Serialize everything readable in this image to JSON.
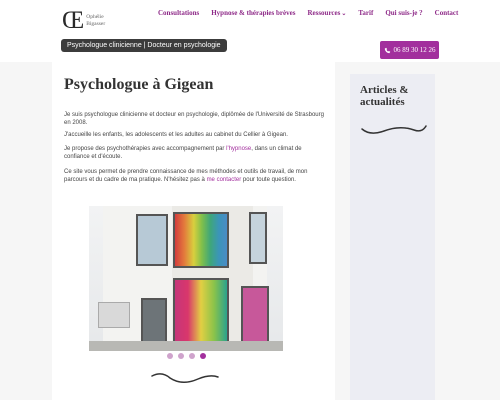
{
  "logo": {
    "mark": "Œ",
    "name_line1": "Ophélie",
    "name_line2": "Bigasser"
  },
  "tagline": "Psychologue clinicienne | Docteur en psychologie",
  "nav": {
    "items": [
      {
        "label": "Consultations"
      },
      {
        "label": "Hypnose & thérapies brèves"
      },
      {
        "label": "Ressources"
      },
      {
        "label": "Tarif"
      },
      {
        "label": "Qui suis-je ?"
      },
      {
        "label": "Contact"
      }
    ]
  },
  "phone": {
    "icon": "phone-icon",
    "number": "06 89 30 12 26"
  },
  "main": {
    "title": "Psychologue à Gigean",
    "p1": "Je suis psychologue clinicienne et docteur en psychologie, diplômée de l'Université de Strasbourg en 2008.",
    "p2": "J'accueille les enfants, les adolescents et les adultes au cabinet du Cellier à Gigean.",
    "p3_before": "Je propose des psychothérapies avec accompagnement par ",
    "p3_link": "l'hypnose",
    "p3_after": ", dans un climat de confiance et d'écoute.",
    "p4_before": "Ce site vous permet de prendre connaissance de mes méthodes et outils de travail, de mon parcours et du cadre de ma pratique. N'hésitez pas à ",
    "p4_link": "me contacter",
    "p4_after": " pour toute question.",
    "slider": {
      "slide_count": 4,
      "active_index": 3
    }
  },
  "sidebar": {
    "title": "Articles & actualités"
  },
  "colors": {
    "accent": "#a22f9d",
    "dark": "#3c3c3c",
    "sidebar_bg": "#ecedf3"
  }
}
